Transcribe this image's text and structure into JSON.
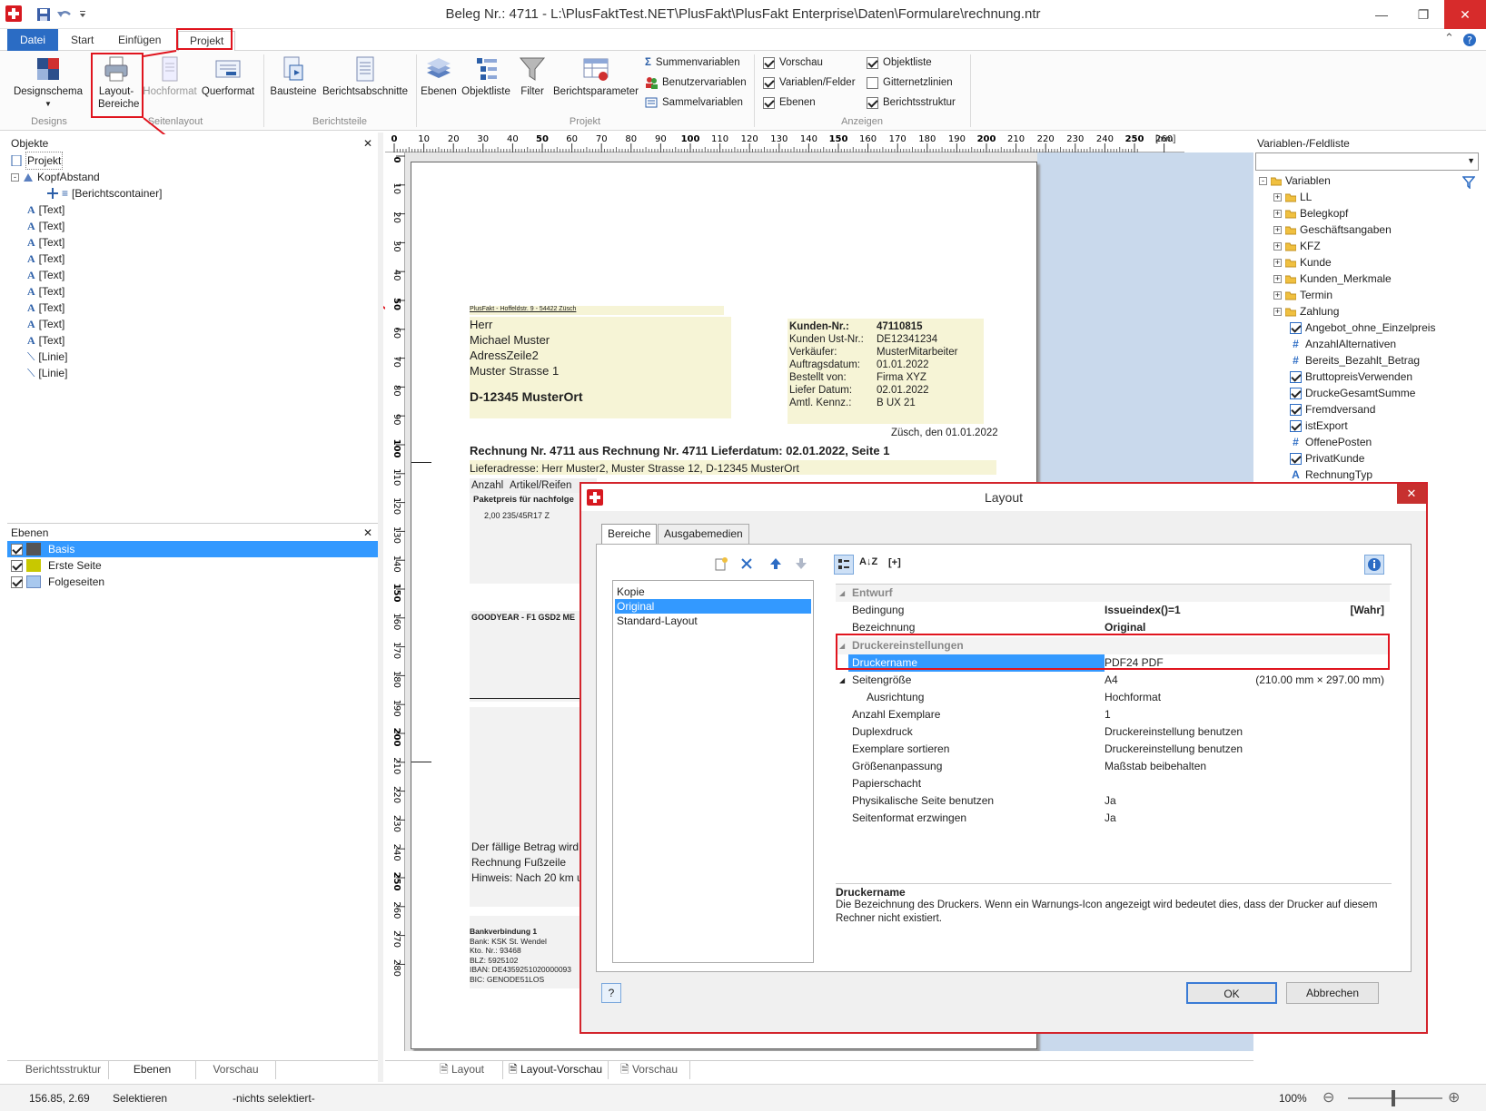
{
  "window": {
    "title": "Beleg Nr.: 4711 - L:\\PlusFaktTest.NET\\PlusFakt\\PlusFakt Enterprise\\Daten\\Formulare\\rechnung.ntr"
  },
  "ribbon_tabs": [
    "Datei",
    "Start",
    "Einfügen",
    "Projekt"
  ],
  "ribbon": {
    "designschema": "Designschema",
    "layout_bereiche": "Layout-Bereiche",
    "hochformat": "Hochformat",
    "querformat": "Querformat",
    "bausteine": "Bausteine",
    "berichtsabschnitte": "Berichtsabschnitte",
    "ebenen": "Ebenen",
    "objektliste": "Objektliste",
    "filter": "Filter",
    "berichtsparameter": "Berichtsparameter",
    "summenvariablen": "Summenvariablen",
    "benutzervariablen": "Benutzervariablen",
    "sammelvariablen": "Sammelvariablen",
    "groups": [
      "Designs",
      "Seitenlayout",
      "Berichtsteile",
      "Projekt",
      "Anzeigen"
    ],
    "anzeigen": [
      {
        "label": "Vorschau",
        "checked": true
      },
      {
        "label": "Variablen/Felder",
        "checked": true
      },
      {
        "label": "Ebenen",
        "checked": true
      },
      {
        "label": "Objektliste",
        "checked": true
      },
      {
        "label": "Gitternetzlinien",
        "checked": false
      },
      {
        "label": "Berichtsstruktur",
        "checked": true
      }
    ]
  },
  "objects_panel": {
    "title": "Objekte",
    "items": [
      "Projekt",
      "KopfAbstand",
      "[Berichtscontainer]",
      "[Text]",
      "[Text]",
      "[Text]",
      "[Text]",
      "[Text]",
      "[Text]",
      "[Text]",
      "[Text]",
      "[Text]",
      "[Linie]",
      "[Linie]"
    ]
  },
  "layers_panel": {
    "title": "Ebenen",
    "items": [
      {
        "label": "Basis",
        "color": "#555555"
      },
      {
        "label": "Erste Seite",
        "color": "#c8c800"
      },
      {
        "label": "Folgeseiten",
        "color": "#a8c8ee"
      }
    ]
  },
  "left_bottom_tabs": [
    "Berichtsstruktur",
    "Ebenen",
    "Vorschau"
  ],
  "center_bottom_tabs": [
    "Layout",
    "Layout-Vorschau",
    "Vorschau"
  ],
  "ruler": {
    "h_ticks": [
      "0",
      "10",
      "20",
      "30",
      "40",
      "50",
      "60",
      "70",
      "80",
      "90",
      "100",
      "110",
      "120",
      "130",
      "140",
      "150",
      "160",
      "170",
      "180",
      "190",
      "200",
      "210",
      "220",
      "230",
      "240",
      "250",
      "260"
    ],
    "v_ticks": [
      "0",
      "10",
      "20",
      "30",
      "40",
      "50",
      "60",
      "70",
      "80",
      "90",
      "100",
      "110",
      "120",
      "130",
      "140",
      "150",
      "160",
      "170",
      "180",
      "190",
      "200",
      "210",
      "220",
      "230",
      "240",
      "250",
      "260",
      "270",
      "280"
    ],
    "unit": "[mm]"
  },
  "document": {
    "sender": "PlusFakt - Hoffeldstr. 9 - 54422 Züsch",
    "address": [
      "Herr",
      "Michael Muster",
      "AdressZeile2",
      "Muster Strasse 1"
    ],
    "city": "D-12345 MusterOrt",
    "info_labels": [
      "Kunden-Nr.:",
      "Kunden Ust-Nr.:",
      "Verkäufer:",
      "Auftragsdatum:",
      "Bestellt von:",
      "Liefer Datum:",
      "Amtl. Kennz.:"
    ],
    "info_values": [
      "47110815",
      "DE12341234",
      "MusterMitarbeiter",
      "01.01.2022",
      "Firma XYZ",
      "02.01.2022",
      "B UX 21"
    ],
    "date_line": "Züsch, den 01.01.2022",
    "headline": "Rechnung Nr. 4711 aus Rechnung Nr. 4711 Lieferdatum: 02.01.2022, Seite 1",
    "delivery": "Lieferadresse: Herr Muster2, Muster Strasse 12, D-12345 MusterOrt",
    "col_anzahl": "Anzahl",
    "col_artikel": "Artikel/Reifen",
    "paket": "Paketpreis für nachfolge",
    "item_line": "2,00   235/45R17 Z",
    "goodyear": "GOODYEAR - F1 GSD2 ME",
    "footer_lines": [
      "Der fällige Betrag wird",
      "Rechnung Fußzeile",
      "Hinweis: Nach 20 km u"
    ],
    "bank": [
      "Bankverbindung 1",
      "Bank: KSK St. Wendel",
      "Kto. Nr.: 93468",
      "BLZ: 5925102",
      "IBAN: DE4359251020000093",
      "BIC: GENODE51LOS"
    ]
  },
  "var_panel": {
    "title": "Variablen-/Feldliste",
    "root": "Variablen",
    "folders": [
      "LL",
      "Belegkopf",
      "Geschäftsangaben",
      "KFZ",
      "Kunde",
      "Kunden_Merkmale",
      "Termin",
      "Zahlung"
    ],
    "vars": [
      {
        "label": "Angebot_ohne_Einzelpreis",
        "kind": "bool"
      },
      {
        "label": "AnzahlAlternativen",
        "kind": "num"
      },
      {
        "label": "Bereits_Bezahlt_Betrag",
        "kind": "num"
      },
      {
        "label": "BruttopreisVerwenden",
        "kind": "bool"
      },
      {
        "label": "DruckeGesamtSumme",
        "kind": "bool"
      },
      {
        "label": "Fremdversand",
        "kind": "bool"
      },
      {
        "label": "istExport",
        "kind": "bool"
      },
      {
        "label": "OffenePosten",
        "kind": "num"
      },
      {
        "label": "PrivatKunde",
        "kind": "bool"
      },
      {
        "label": "RechnungTyp",
        "kind": "text"
      }
    ]
  },
  "status": {
    "coords": "156.85, 2.69",
    "mode": "Selektieren",
    "selection": "-nichts selektiert-",
    "zoom": "100%"
  },
  "dialog": {
    "title": "Layout",
    "tabs": [
      "Bereiche",
      "Ausgabemedien"
    ],
    "list": [
      "Kopie",
      "Original",
      "Standard-Layout"
    ],
    "selected": "Original",
    "sort_label": "[+]",
    "sections": {
      "entwurf": "Entwurf",
      "drucker": "Druckereinstellungen"
    },
    "props": [
      {
        "key": "Bedingung",
        "value": "Issueindex()=1",
        "extra": "[Wahr]",
        "bold": true
      },
      {
        "key": "Bezeichnung",
        "value": "Original",
        "extra": "",
        "bold": true
      }
    ],
    "druckername": {
      "key": "Druckername",
      "value": "PDF24 PDF"
    },
    "printer_props": [
      {
        "key": "Seitengröße",
        "value": "A4",
        "extra": "(210.00 mm × 297.00 mm)"
      },
      {
        "key": "Ausrichtung",
        "value": "Hochformat",
        "extra": ""
      },
      {
        "key": "Anzahl Exemplare",
        "value": "1",
        "extra": ""
      },
      {
        "key": "Duplexdruck",
        "value": "Druckereinstellung benutzen",
        "extra": ""
      },
      {
        "key": "Exemplare sortieren",
        "value": "Druckereinstellung benutzen",
        "extra": ""
      },
      {
        "key": "Größenanpassung",
        "value": "Maßstab beibehalten",
        "extra": ""
      },
      {
        "key": "Papierschacht",
        "value": "",
        "extra": ""
      },
      {
        "key": "Physikalische Seite benutzen",
        "value": "Ja",
        "extra": ""
      },
      {
        "key": "Seitenformat erzwingen",
        "value": "Ja",
        "extra": ""
      }
    ],
    "desc_title": "Druckername",
    "desc_text": "Die Bezeichnung des Druckers. Wenn ein Warnungs-Icon angezeigt wird bedeutet dies, dass der Drucker auf diesem Rechner nicht existiert.",
    "ok": "OK",
    "cancel": "Abbrechen"
  }
}
